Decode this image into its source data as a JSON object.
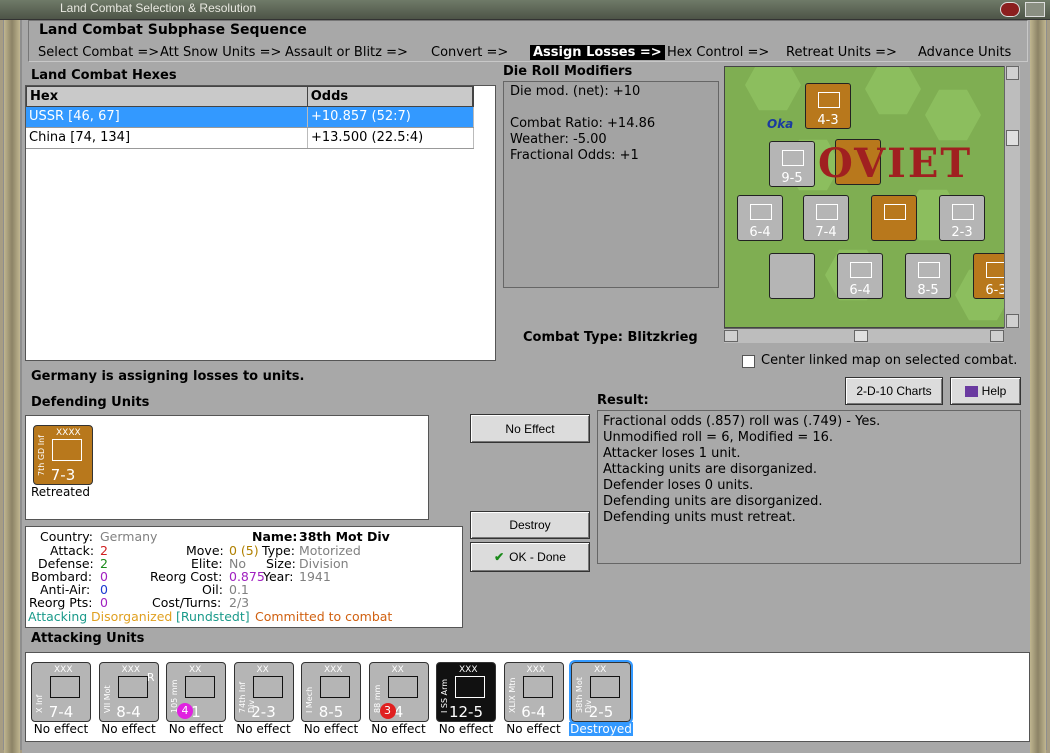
{
  "window": {
    "title": "Land Combat Selection & Resolution"
  },
  "sequence": {
    "title": "Land Combat Subphase Sequence",
    "steps": [
      "Select Combat =>",
      "Att Snow Units =>",
      "Assault or Blitz =>",
      "Convert =>",
      "Assign Losses =>",
      "Hex Control =>",
      "Retreat Units =>",
      "Advance Units"
    ],
    "active_index": 4
  },
  "hexes": {
    "title": "Land Combat Hexes",
    "headers": [
      "Hex",
      "Odds"
    ],
    "rows": [
      {
        "hex": "USSR [46, 67]",
        "odds": "+10.857 (52:7)"
      },
      {
        "hex": "China [74, 134]",
        "odds": "+13.500 (22.5:4)"
      }
    ],
    "selected": 0
  },
  "die_roll": {
    "title": "Die Roll Modifiers",
    "lines": [
      "Die mod. (net): +10",
      "",
      "Combat Ratio: +14.86",
      "Weather: -5.00",
      "Fractional Odds: +1"
    ]
  },
  "combat_type": {
    "label": "Combat Type:",
    "value": "Blitzkrieg"
  },
  "map": {
    "center_checkbox": "Center linked map on selected combat.",
    "label_river": "Oka",
    "label_text": "OVIET"
  },
  "status": "Germany is assigning losses to units.",
  "defending": {
    "title": "Defending Units",
    "units": [
      {
        "name": "7th GD Inf",
        "size": "XXXX",
        "strength": "7-3",
        "caption": "Retreated"
      }
    ]
  },
  "buttons": {
    "no_effect": "No Effect",
    "destroy": "Destroy",
    "ok_done": "OK - Done",
    "charts": "2-D-10 Charts",
    "help": "Help"
  },
  "info": {
    "country_label": "Country:",
    "country": "Germany",
    "name_label": "Name:",
    "name": "38th Mot Div",
    "attack_label": "Attack:",
    "attack": "2",
    "move_label": "Move:",
    "move": "0 (5)",
    "type_label": "Type:",
    "type": "Motorized",
    "defense_label": "Defense:",
    "defense": "2",
    "elite_label": "Elite:",
    "elite": "No",
    "size_label": "Size:",
    "size": "Division",
    "bombard_label": "Bombard:",
    "bombard": "0",
    "reorg_cost_label": "Reorg Cost:",
    "reorg_cost": "0.875",
    "year_label": "Year:",
    "year": "1941",
    "antiair_label": "Anti-Air:",
    "antiair": "0",
    "oil_label": "Oil:",
    "oil": "0.1",
    "reorg_pts_label": "Reorg Pts:",
    "reorg_pts": "0",
    "cost_label": "Cost/Turns:",
    "cost": "2/3",
    "flags": {
      "attacking": "Attacking",
      "disorg": "Disorganized",
      "hq": "[Rundstedt]",
      "committed": "Committed to combat"
    }
  },
  "result": {
    "title": "Result:",
    "lines": [
      "Fractional odds (.857) roll was (.749)  - Yes.",
      "Unmodified roll = 6, Modified = 16.",
      "Attacker loses 1 unit.",
      "Attacking units are disorganized.",
      "Defender loses 0 units.",
      "Defending units are disorganized.",
      "Defending units must retreat."
    ]
  },
  "attacking": {
    "title": "Attacking Units",
    "units": [
      {
        "name": "X Inf",
        "size": "XXX",
        "strength": "7-4",
        "caption": "No effect",
        "bg": "#b5b5b5",
        "badge": ""
      },
      {
        "name": "VII Mot",
        "size": "XXX",
        "strength": "8-4",
        "caption": "No effect",
        "bg": "#b5b5b5",
        "badge": "R"
      },
      {
        "name": "105 mm",
        "size": "XX",
        "strength": "1",
        "caption": "No effect",
        "bg": "#b5b5b5",
        "badge": "4"
      },
      {
        "name": "74th Inf Div",
        "size": "XX",
        "strength": "2-3",
        "caption": "No effect",
        "bg": "#b5b5b5",
        "badge": ""
      },
      {
        "name": "I Mech",
        "size": "XXX",
        "strength": "8-5",
        "caption": "No effect",
        "bg": "#b5b5b5",
        "badge": ""
      },
      {
        "name": "88 mm",
        "size": "XX",
        "strength": "4",
        "caption": "No effect",
        "bg": "#b5b5b5",
        "badge": "3"
      },
      {
        "name": "I SS Arm",
        "size": "XXX",
        "strength": "12-5",
        "caption": "No effect",
        "bg": "#111111",
        "badge": ""
      },
      {
        "name": "XLIX Mtn",
        "size": "XXX",
        "strength": "6-4",
        "caption": "No effect",
        "bg": "#b5b5b5",
        "badge": ""
      },
      {
        "name": "38th Mot Div",
        "size": "XX",
        "strength": "2-5",
        "caption": "Destroyed",
        "bg": "#b5b5b5",
        "badge": ""
      }
    ]
  }
}
